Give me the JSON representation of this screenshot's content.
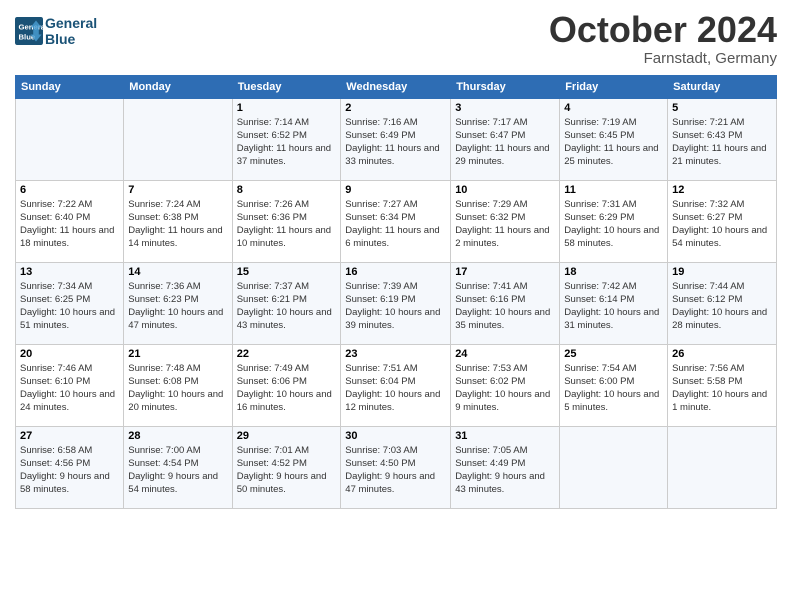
{
  "header": {
    "logo_line1": "General",
    "logo_line2": "Blue",
    "month": "October 2024",
    "location": "Farnstadt, Germany"
  },
  "weekdays": [
    "Sunday",
    "Monday",
    "Tuesday",
    "Wednesday",
    "Thursday",
    "Friday",
    "Saturday"
  ],
  "rows": [
    [
      {
        "day": "",
        "info": ""
      },
      {
        "day": "",
        "info": ""
      },
      {
        "day": "1",
        "info": "Sunrise: 7:14 AM\nSunset: 6:52 PM\nDaylight: 11 hours\nand 37 minutes."
      },
      {
        "day": "2",
        "info": "Sunrise: 7:16 AM\nSunset: 6:49 PM\nDaylight: 11 hours\nand 33 minutes."
      },
      {
        "day": "3",
        "info": "Sunrise: 7:17 AM\nSunset: 6:47 PM\nDaylight: 11 hours\nand 29 minutes."
      },
      {
        "day": "4",
        "info": "Sunrise: 7:19 AM\nSunset: 6:45 PM\nDaylight: 11 hours\nand 25 minutes."
      },
      {
        "day": "5",
        "info": "Sunrise: 7:21 AM\nSunset: 6:43 PM\nDaylight: 11 hours\nand 21 minutes."
      }
    ],
    [
      {
        "day": "6",
        "info": "Sunrise: 7:22 AM\nSunset: 6:40 PM\nDaylight: 11 hours\nand 18 minutes."
      },
      {
        "day": "7",
        "info": "Sunrise: 7:24 AM\nSunset: 6:38 PM\nDaylight: 11 hours\nand 14 minutes."
      },
      {
        "day": "8",
        "info": "Sunrise: 7:26 AM\nSunset: 6:36 PM\nDaylight: 11 hours\nand 10 minutes."
      },
      {
        "day": "9",
        "info": "Sunrise: 7:27 AM\nSunset: 6:34 PM\nDaylight: 11 hours\nand 6 minutes."
      },
      {
        "day": "10",
        "info": "Sunrise: 7:29 AM\nSunset: 6:32 PM\nDaylight: 11 hours\nand 2 minutes."
      },
      {
        "day": "11",
        "info": "Sunrise: 7:31 AM\nSunset: 6:29 PM\nDaylight: 10 hours\nand 58 minutes."
      },
      {
        "day": "12",
        "info": "Sunrise: 7:32 AM\nSunset: 6:27 PM\nDaylight: 10 hours\nand 54 minutes."
      }
    ],
    [
      {
        "day": "13",
        "info": "Sunrise: 7:34 AM\nSunset: 6:25 PM\nDaylight: 10 hours\nand 51 minutes."
      },
      {
        "day": "14",
        "info": "Sunrise: 7:36 AM\nSunset: 6:23 PM\nDaylight: 10 hours\nand 47 minutes."
      },
      {
        "day": "15",
        "info": "Sunrise: 7:37 AM\nSunset: 6:21 PM\nDaylight: 10 hours\nand 43 minutes."
      },
      {
        "day": "16",
        "info": "Sunrise: 7:39 AM\nSunset: 6:19 PM\nDaylight: 10 hours\nand 39 minutes."
      },
      {
        "day": "17",
        "info": "Sunrise: 7:41 AM\nSunset: 6:16 PM\nDaylight: 10 hours\nand 35 minutes."
      },
      {
        "day": "18",
        "info": "Sunrise: 7:42 AM\nSunset: 6:14 PM\nDaylight: 10 hours\nand 31 minutes."
      },
      {
        "day": "19",
        "info": "Sunrise: 7:44 AM\nSunset: 6:12 PM\nDaylight: 10 hours\nand 28 minutes."
      }
    ],
    [
      {
        "day": "20",
        "info": "Sunrise: 7:46 AM\nSunset: 6:10 PM\nDaylight: 10 hours\nand 24 minutes."
      },
      {
        "day": "21",
        "info": "Sunrise: 7:48 AM\nSunset: 6:08 PM\nDaylight: 10 hours\nand 20 minutes."
      },
      {
        "day": "22",
        "info": "Sunrise: 7:49 AM\nSunset: 6:06 PM\nDaylight: 10 hours\nand 16 minutes."
      },
      {
        "day": "23",
        "info": "Sunrise: 7:51 AM\nSunset: 6:04 PM\nDaylight: 10 hours\nand 12 minutes."
      },
      {
        "day": "24",
        "info": "Sunrise: 7:53 AM\nSunset: 6:02 PM\nDaylight: 10 hours\nand 9 minutes."
      },
      {
        "day": "25",
        "info": "Sunrise: 7:54 AM\nSunset: 6:00 PM\nDaylight: 10 hours\nand 5 minutes."
      },
      {
        "day": "26",
        "info": "Sunrise: 7:56 AM\nSunset: 5:58 PM\nDaylight: 10 hours\nand 1 minute."
      }
    ],
    [
      {
        "day": "27",
        "info": "Sunrise: 6:58 AM\nSunset: 4:56 PM\nDaylight: 9 hours\nand 58 minutes."
      },
      {
        "day": "28",
        "info": "Sunrise: 7:00 AM\nSunset: 4:54 PM\nDaylight: 9 hours\nand 54 minutes."
      },
      {
        "day": "29",
        "info": "Sunrise: 7:01 AM\nSunset: 4:52 PM\nDaylight: 9 hours\nand 50 minutes."
      },
      {
        "day": "30",
        "info": "Sunrise: 7:03 AM\nSunset: 4:50 PM\nDaylight: 9 hours\nand 47 minutes."
      },
      {
        "day": "31",
        "info": "Sunrise: 7:05 AM\nSunset: 4:49 PM\nDaylight: 9 hours\nand 43 minutes."
      },
      {
        "day": "",
        "info": ""
      },
      {
        "day": "",
        "info": ""
      }
    ]
  ]
}
